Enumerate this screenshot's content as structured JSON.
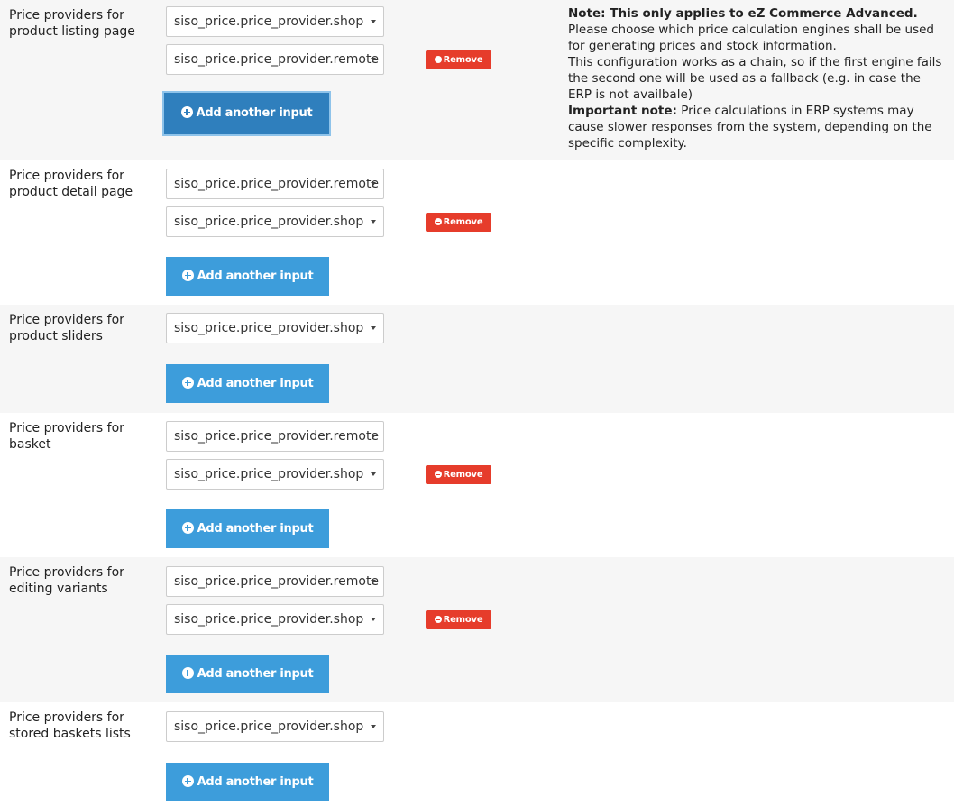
{
  "sections": [
    {
      "label": "Price providers for\nproduct listing page",
      "selects": [
        "siso_price.price_provider.shop",
        "siso_price.price_provider.remote"
      ],
      "remove_label": "Remove",
      "add_label": "Add another input"
    },
    {
      "label": "Price providers for\nproduct detail page",
      "selects": [
        "siso_price.price_provider.remote",
        "siso_price.price_provider.shop"
      ],
      "remove_label": "Remove",
      "add_label": "Add another input"
    },
    {
      "label": "Price providers for\nproduct sliders",
      "selects": [
        "siso_price.price_provider.shop"
      ],
      "add_label": "Add another input"
    },
    {
      "label": "Price providers for\nbasket",
      "selects": [
        "siso_price.price_provider.remote",
        "siso_price.price_provider.shop"
      ],
      "remove_label": "Remove",
      "add_label": "Add another input"
    },
    {
      "label": "Price providers for\nediting variants",
      "selects": [
        "siso_price.price_provider.remote",
        "siso_price.price_provider.shop"
      ],
      "remove_label": "Remove",
      "add_label": "Add another input"
    },
    {
      "label": "Price providers for\nstored baskets lists",
      "selects": [
        "siso_price.price_provider.shop"
      ],
      "add_label": "Add another input"
    }
  ],
  "note": {
    "title": "Note: This only applies to eZ Commerce Advanced.",
    "line1": "Please choose which price calculation engines shall be used for generating prices and stock information.",
    "line2": "This configuration works as a chain, so if the first engine fails the second one will be used as a fallback (e.g. in case the ERP is not availbale)",
    "important_label": "Important note:",
    "important_text": " Price calculations in ERP systems may cause slower responses from the system, depending on the specific complexity."
  },
  "colors": {
    "add_button": "#3d9ddb",
    "add_button_focused": "#2f7fbd",
    "remove_button": "#e63c2b",
    "shaded_row": "#f6f6f6"
  },
  "icons": {
    "add": "plus-circle-icon",
    "remove": "minus-circle-icon",
    "select": "caret-down-icon"
  }
}
